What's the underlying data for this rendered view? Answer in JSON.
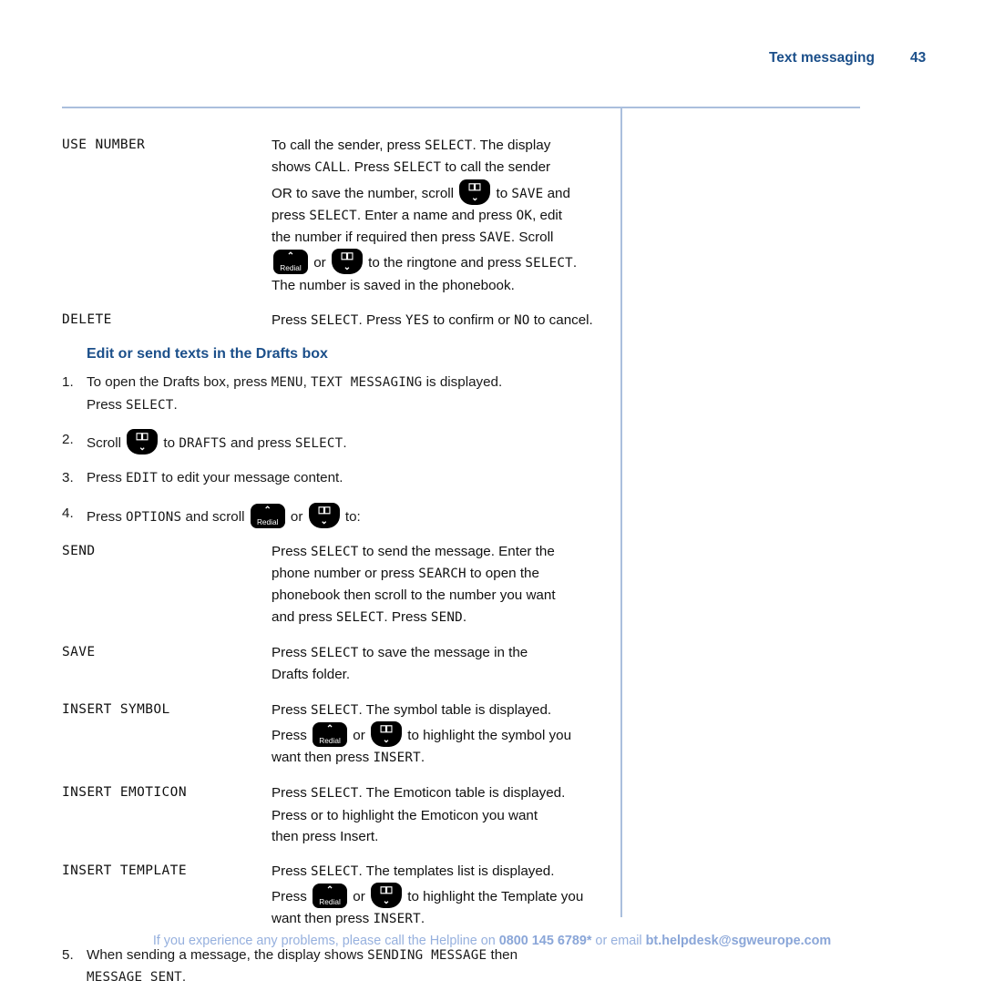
{
  "header": {
    "title": "Text messaging",
    "page_number": "43"
  },
  "definitions_top": [
    {
      "term": "USE NUMBER",
      "lines": [
        [
          {
            "t": "To call the sender, press "
          },
          {
            "t": "SELECT",
            "lcd": true
          },
          {
            "t": ". The display"
          }
        ],
        [
          {
            "t": "shows "
          },
          {
            "t": "CALL",
            "lcd": true
          },
          {
            "t": ". Press "
          },
          {
            "t": "SELECT",
            "lcd": true
          },
          {
            "t": " to call the sender"
          }
        ],
        [
          {
            "t": "OR to save the number, scroll "
          },
          {
            "icon": "down-scroll-key"
          },
          {
            "t": " to "
          },
          {
            "t": "SAVE",
            "lcd": true
          },
          {
            "t": " and"
          }
        ],
        [
          {
            "t": "press "
          },
          {
            "t": "SELECT",
            "lcd": true
          },
          {
            "t": ". Enter a name and press "
          },
          {
            "t": "OK",
            "lcd": true
          },
          {
            "t": ", edit"
          }
        ],
        [
          {
            "t": "the number if required then press "
          },
          {
            "t": "SAVE",
            "lcd": true
          },
          {
            "t": ". Scroll"
          }
        ],
        [
          {
            "icon": "redial-key"
          },
          {
            "t": " or "
          },
          {
            "icon": "down-scroll-key"
          },
          {
            "t": " to the ringtone and press "
          },
          {
            "t": "SELECT",
            "lcd": true
          },
          {
            "t": "."
          }
        ],
        [
          {
            "t": "The number is saved in the phonebook."
          }
        ]
      ]
    },
    {
      "term": "DELETE",
      "lines": [
        [
          {
            "t": "Press "
          },
          {
            "t": "SELECT",
            "lcd": true
          },
          {
            "t": ". Press "
          },
          {
            "t": "YES",
            "lcd": true
          },
          {
            "t": " to confirm or "
          },
          {
            "t": "NO",
            "lcd": true
          },
          {
            "t": " to cancel."
          }
        ]
      ]
    }
  ],
  "subheading": "Edit or send texts in the Drafts box",
  "steps_top": [
    {
      "num": "1.",
      "lines": [
        [
          {
            "t": "To open the Drafts box, press "
          },
          {
            "t": "MENU",
            "lcd": true
          },
          {
            "t": ", "
          },
          {
            "t": "TEXT MESSAGING",
            "lcd": true
          },
          {
            "t": " is displayed."
          }
        ],
        [
          {
            "t": "Press "
          },
          {
            "t": "SELECT",
            "lcd": true
          },
          {
            "t": "."
          }
        ]
      ]
    },
    {
      "num": "2.",
      "lines": [
        [
          {
            "t": "Scroll "
          },
          {
            "icon": "down-scroll-key"
          },
          {
            "t": " to "
          },
          {
            "t": "DRAFTS",
            "lcd": true
          },
          {
            "t": " and press "
          },
          {
            "t": "SELECT",
            "lcd": true
          },
          {
            "t": "."
          }
        ]
      ]
    },
    {
      "num": "3.",
      "lines": [
        [
          {
            "t": "Press "
          },
          {
            "t": "EDIT",
            "lcd": true
          },
          {
            "t": " to edit your message content."
          }
        ]
      ]
    },
    {
      "num": "4.",
      "lines": [
        [
          {
            "t": "Press "
          },
          {
            "t": "OPTIONS",
            "lcd": true
          },
          {
            "t": " and scroll "
          },
          {
            "icon": "redial-key"
          },
          {
            "t": " or "
          },
          {
            "icon": "down-scroll-key"
          },
          {
            "t": " to:"
          }
        ]
      ]
    }
  ],
  "definitions_options": [
    {
      "term": "SEND",
      "lines": [
        [
          {
            "t": "Press "
          },
          {
            "t": "SELECT",
            "lcd": true
          },
          {
            "t": " to send the message. Enter the"
          }
        ],
        [
          {
            "t": "phone number or press "
          },
          {
            "t": "SEARCH",
            "lcd": true
          },
          {
            "t": " to open the"
          }
        ],
        [
          {
            "t": "phonebook then scroll to the number you want"
          }
        ],
        [
          {
            "t": "and press "
          },
          {
            "t": "SELECT",
            "lcd": true
          },
          {
            "t": ". Press "
          },
          {
            "t": "SEND",
            "lcd": true
          },
          {
            "t": "."
          }
        ]
      ]
    },
    {
      "term": "SAVE",
      "lines": [
        [
          {
            "t": "Press "
          },
          {
            "t": "SELECT",
            "lcd": true
          },
          {
            "t": " to save the message in the"
          }
        ],
        [
          {
            "t": "Drafts folder."
          }
        ]
      ]
    },
    {
      "term": "INSERT SYMBOL",
      "lines": [
        [
          {
            "t": "Press "
          },
          {
            "t": "SELECT",
            "lcd": true
          },
          {
            "t": ". The symbol table is displayed."
          }
        ],
        [
          {
            "t": "Press "
          },
          {
            "icon": "redial-key"
          },
          {
            "t": " or "
          },
          {
            "icon": "down-scroll-key"
          },
          {
            "t": " to highlight the symbol you"
          }
        ],
        [
          {
            "t": "want then press "
          },
          {
            "t": "INSERT",
            "lcd": true
          },
          {
            "t": "."
          }
        ]
      ]
    },
    {
      "term": "INSERT EMOTICON",
      "lines": [
        [
          {
            "t": "Press "
          },
          {
            "t": "SELECT",
            "lcd": true
          },
          {
            "t": ". The Emoticon table is displayed."
          }
        ],
        [
          {
            "t": "Press  or  to highlight the Emoticon you want"
          }
        ],
        [
          {
            "t": "then press Insert."
          }
        ]
      ]
    },
    {
      "term": "INSERT TEMPLATE",
      "lines": [
        [
          {
            "t": "Press "
          },
          {
            "t": "SELECT",
            "lcd": true
          },
          {
            "t": ". The templates list is displayed."
          }
        ],
        [
          {
            "t": "Press "
          },
          {
            "icon": "redial-key"
          },
          {
            "t": " or "
          },
          {
            "icon": "down-scroll-key"
          },
          {
            "t": " to highlight the Template you"
          }
        ],
        [
          {
            "t": "want then press "
          },
          {
            "t": "INSERT",
            "lcd": true
          },
          {
            "t": "."
          }
        ]
      ]
    }
  ],
  "steps_bottom": [
    {
      "num": "5.",
      "lines": [
        [
          {
            "t": "When sending a message, the display shows "
          },
          {
            "t": "SENDING MESSAGE",
            "lcd": true
          },
          {
            "t": " then"
          }
        ],
        [
          {
            "t": "MESSAGE SENT",
            "lcd": true
          },
          {
            "t": "."
          }
        ]
      ]
    }
  ],
  "footer": {
    "lead": "If you experience any problems, please call the Helpline on ",
    "phone": "0800 145 6789*",
    "middle": " or email ",
    "email": "bt.helpdesk@sgweurope.com"
  },
  "icons": {
    "redial_label": "Redial",
    "up_chevron": "⌃",
    "down_chevron": "⌄"
  },
  "colors": {
    "accent_blue": "#1b4f8a",
    "rule_blue": "#aabfdd",
    "footer_blue": "#96b0de",
    "key_black": "#000000"
  }
}
